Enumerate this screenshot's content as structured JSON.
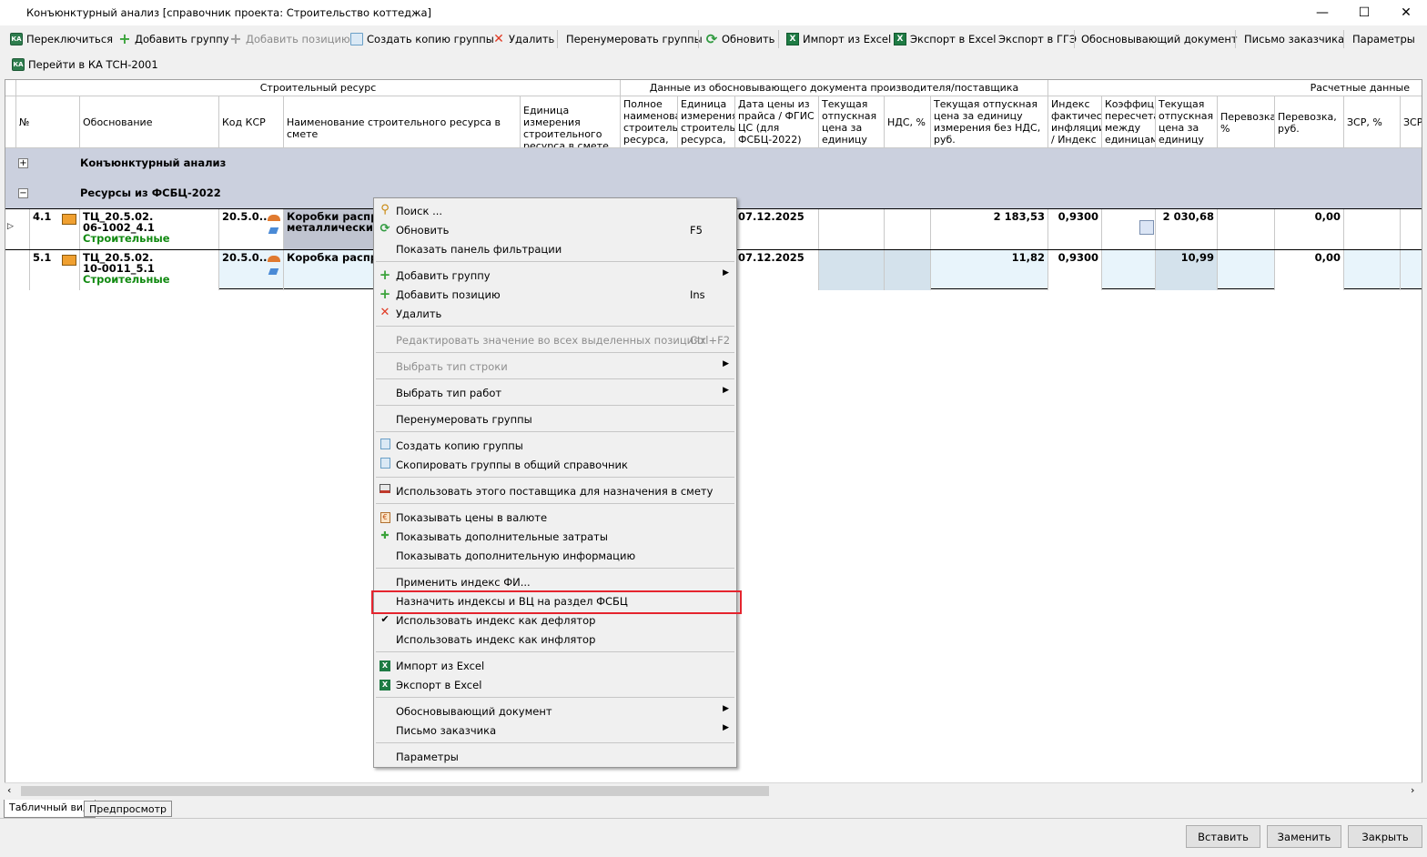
{
  "window": {
    "title": "Конъюнктурный анализ [справочник проекта: Строительство коттеджа]"
  },
  "toolbar": {
    "switch": "Переключиться",
    "add_group": "Добавить группу",
    "add_position": "Добавить позицию",
    "copy_group": "Создать копию группы",
    "delete": "Удалить",
    "renumber": "Перенумеровать группы",
    "refresh": "Обновить",
    "import_excel": "Импорт из Excel",
    "export_excel": "Экспорт в Excel",
    "export_gge": "Экспорт в ГГЭ",
    "justify_doc": "Обосновывающий документ",
    "customer_letter": "Письмо заказчика",
    "params": "Параметры",
    "goto_ka": "Перейти в КА ТСН-2001"
  },
  "grid": {
    "band_resource": "Строительный ресурс",
    "band_supplier": "Данные из обосновывающего документа производителя/поставщика",
    "band_calc": "Расчетные данные",
    "columns": {
      "num": "№",
      "basis": "Обоснование",
      "ksr": "Код КСР",
      "name": "Наименование строительного ресурса в смете",
      "unit": "Единица измерения строительного ресурса в смете",
      "fullname": "Полное наименование строительного ресурса,",
      "unit2": "Единица измерения строительного ресурса,",
      "date": "Дата цены из прайса / ФГИС ЦС (для ФСБЦ-2022)",
      "cur_price": "Текущая отпускная цена за единицу",
      "nds": "НДС, %",
      "price_no_nds": "Текущая отпускная цена за единицу измерения без НДС, руб.",
      "infl": "Индекс фактической инфляции / Индекс",
      "coef": "Коэффициент пересчета между единицами",
      "cur_price2": "Текущая отпускная цена за единицу",
      "transport_pct": "Перевозка, %",
      "transport_rub": "Перевозка, руб.",
      "zsr_pct": "ЗСР, %",
      "zsr": "ЗСР"
    },
    "groups": [
      {
        "label": "Конъюнктурный анализ",
        "toggle": "+"
      },
      {
        "label": "Ресурсы из ФСБЦ-2022",
        "toggle": "−"
      }
    ],
    "rows": [
      {
        "num": "4.1",
        "basis1": "ТЦ_20.5.02.",
        "basis2": "06-1002_4.1",
        "type": "Строительные",
        "ksr": "20.5.0...",
        "name1": "Коробки распре",
        "name2": "металлические,",
        "date": "07.12.2025",
        "price_no_nds": "2 183,53",
        "infl": "0,9300",
        "cur_price2": "2 030,68",
        "transport_rub": "0,00"
      },
      {
        "num": "5.1",
        "basis1": "ТЦ_20.5.02.",
        "basis2": "10-0011_5.1",
        "type": "Строительные",
        "ksr": "20.5.0...",
        "name1": "Коробка распре",
        "name2": "",
        "date": "07.12.2025",
        "price_no_nds": "11,82",
        "infl": "0,9300",
        "cur_price2": "10,99",
        "transport_rub": "0,00"
      }
    ]
  },
  "tabs": {
    "table": "Табличный вид",
    "preview": "Предпросмотр"
  },
  "buttons": {
    "insert": "Вставить",
    "replace": "Заменить",
    "close": "Закрыть"
  },
  "context_menu": {
    "search": "Поиск ...",
    "refresh": "Обновить",
    "refresh_key": "F5",
    "show_filter": "Показать панель фильтрации",
    "add_group": "Добавить группу",
    "add_position": "Добавить позицию",
    "add_position_key": "Ins",
    "delete": "Удалить",
    "edit_all": "Редактировать значение во всех выделенных позициях",
    "edit_all_key": "Ctrl+F2",
    "row_type": "Выбрать тип строки",
    "work_type": "Выбрать тип работ",
    "renumber": "Перенумеровать группы",
    "copy_group": "Создать копию группы",
    "copy_to_common": "Скопировать группы в общий справочник",
    "use_supplier": "Использовать этого поставщика для назначения в смету",
    "show_currency": "Показывать цены в валюте",
    "show_extra_costs": "Показывать дополнительные затраты",
    "show_extra_info": "Показывать дополнительную информацию",
    "apply_index": "Применить индекс ФИ...",
    "assign_indices": "Назначить индексы и ВЦ на раздел ФСБЦ",
    "use_deflator": "Использовать индекс как дефлятор",
    "use_inflator": "Использовать индекс как инфлятор",
    "import_excel": "Импорт из Excel",
    "export_excel": "Экспорт в Excel",
    "justify_doc": "Обосновывающий документ",
    "customer_letter": "Письмо заказчика",
    "params": "Параметры"
  },
  "colors": {
    "group_row": "#cbd0de",
    "highlight": "#e5242e",
    "type_green": "#118a11"
  }
}
